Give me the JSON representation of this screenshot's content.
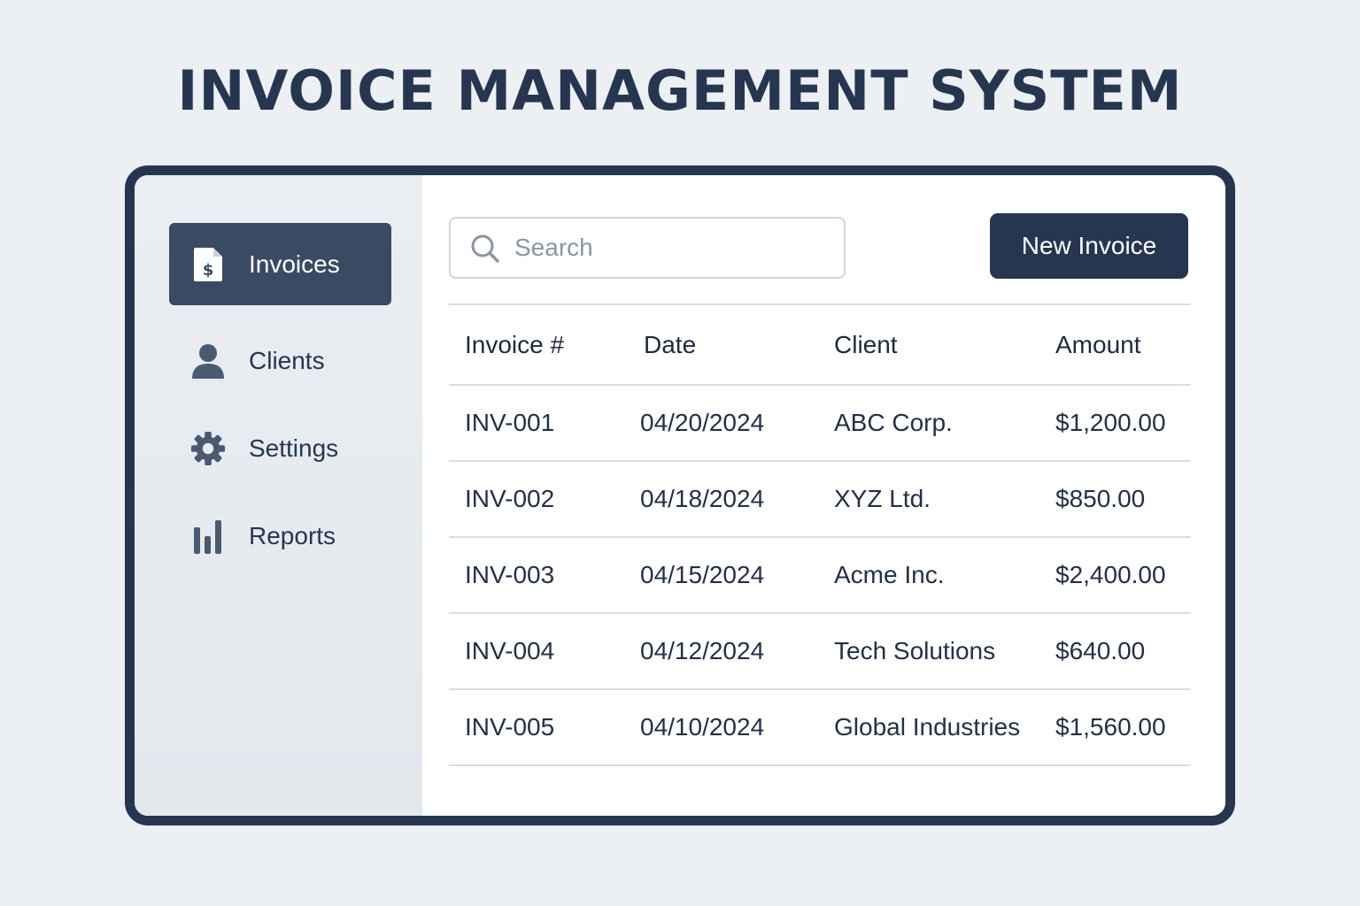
{
  "app": {
    "title": "INVOICE MANAGEMENT SYSTEM"
  },
  "sidebar": {
    "items": [
      {
        "label": "Invoices",
        "icon": "invoice-dollar-icon",
        "active": true
      },
      {
        "label": "Clients",
        "icon": "user-icon",
        "active": false
      },
      {
        "label": "Settings",
        "icon": "gear-icon",
        "active": false
      },
      {
        "label": "Reports",
        "icon": "bar-chart-icon",
        "active": false
      }
    ]
  },
  "toolbar": {
    "search": {
      "placeholder": "Search",
      "value": "",
      "icon": "search-icon"
    },
    "new_invoice_label": "New Invoice"
  },
  "table": {
    "columns": [
      "Invoice #",
      "Date",
      "Client",
      "Amount"
    ],
    "rows": [
      [
        "INV-001",
        "04/20/2024",
        "ABC Corp.",
        "$1,200.00"
      ],
      [
        "INV-002",
        "04/18/2024",
        "XYZ Ltd.",
        "$850.00"
      ],
      [
        "INV-003",
        "04/15/2024",
        "Acme Inc.",
        "$2,400.00"
      ],
      [
        "INV-004",
        "04/12/2024",
        "Tech Solutions",
        "$640.00"
      ],
      [
        "INV-005",
        "04/10/2024",
        "Global Industries",
        "$1,560.00"
      ]
    ]
  },
  "colors": {
    "primary": "#263650",
    "active_nav": "#3a4a63",
    "sidebar_bg": "#e6ebef",
    "page_bg": "#ecf0f3",
    "divider": "#d7dee5"
  }
}
